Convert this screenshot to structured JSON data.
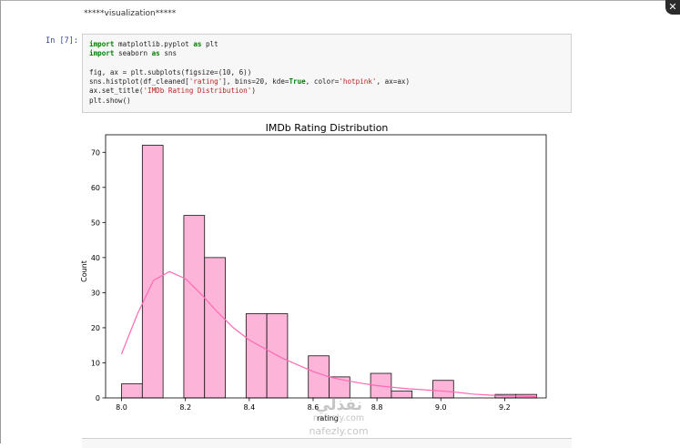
{
  "notebook": {
    "markdown_heading": "*****visualization*****",
    "cell_prompt": "In [7]:",
    "code_lines": [
      [
        {
          "t": "import",
          "c": "kw"
        },
        {
          "t": " matplotlib.pyplot "
        },
        {
          "t": "as",
          "c": "kw"
        },
        {
          "t": " plt"
        }
      ],
      [
        {
          "t": "import",
          "c": "kw"
        },
        {
          "t": " seaborn "
        },
        {
          "t": "as",
          "c": "kw"
        },
        {
          "t": " sns"
        }
      ],
      [],
      [
        {
          "t": "fig, ax = plt.subplots(figsize=(10, 6))"
        }
      ],
      [
        {
          "t": "sns.histplot(df_cleaned["
        },
        {
          "t": "'rating'",
          "c": "str"
        },
        {
          "t": "], bins=20, kde="
        },
        {
          "t": "True",
          "c": "bool"
        },
        {
          "t": ", color="
        },
        {
          "t": "'hotpink'",
          "c": "str"
        },
        {
          "t": ", ax=ax)"
        }
      ],
      [
        {
          "t": "ax.set_title("
        },
        {
          "t": "'IMDb Rating Distribution'",
          "c": "str"
        },
        {
          "t": ")"
        }
      ],
      [
        {
          "t": "plt.show()"
        }
      ]
    ]
  },
  "chart_data": {
    "type": "bar",
    "title": "IMDb Rating Distribution",
    "xlabel": "rating",
    "ylabel": "Count",
    "xlim": [
      7.95,
      9.33
    ],
    "ylim": [
      0,
      75
    ],
    "xticks": [
      "8.0",
      "8.2",
      "8.4",
      "8.6",
      "8.8",
      "9.0",
      "9.2"
    ],
    "xtick_values": [
      8.0,
      8.2,
      8.4,
      8.6,
      8.8,
      9.0,
      9.2
    ],
    "yticks": [
      "0",
      "10",
      "20",
      "30",
      "40",
      "50",
      "60",
      "70"
    ],
    "ytick_values": [
      0,
      10,
      20,
      30,
      40,
      50,
      60,
      70
    ],
    "bin_edges": [
      8.0,
      8.065,
      8.13,
      8.195,
      8.26,
      8.325,
      8.39,
      8.455,
      8.52,
      8.585,
      8.65,
      8.715,
      8.78,
      8.845,
      8.91,
      8.975,
      9.04,
      9.105,
      9.17,
      9.235,
      9.3
    ],
    "counts": [
      4,
      72,
      0,
      52,
      40,
      0,
      24,
      24,
      0,
      12,
      6,
      0,
      7,
      2,
      0,
      5,
      0,
      0,
      1,
      1
    ],
    "kde": {
      "x": [
        8.0,
        8.05,
        8.1,
        8.15,
        8.2,
        8.25,
        8.3,
        8.35,
        8.4,
        8.45,
        8.5,
        8.55,
        8.6,
        8.65,
        8.7,
        8.75,
        8.8,
        8.85,
        8.9,
        8.95,
        9.0,
        9.05,
        9.1,
        9.15,
        9.2,
        9.25,
        9.3
      ],
      "y": [
        12.5,
        24,
        33.5,
        36,
        34,
        29.5,
        24.5,
        20,
        16.5,
        14,
        11.5,
        9.5,
        7.5,
        6,
        5,
        4.2,
        3.5,
        3,
        2.6,
        2.3,
        2.0,
        1.6,
        1.1,
        0.8,
        0.6,
        0.5,
        0.4
      ]
    },
    "bar_fill": "#fcb4d8",
    "bar_edge": "#111111",
    "kde_color": "#ff69b4",
    "grid": false
  },
  "watermark": {
    "logo_text": "نفذلي",
    "domain_line": "nafezly.com",
    "domain_line2": "nafezly.com"
  }
}
